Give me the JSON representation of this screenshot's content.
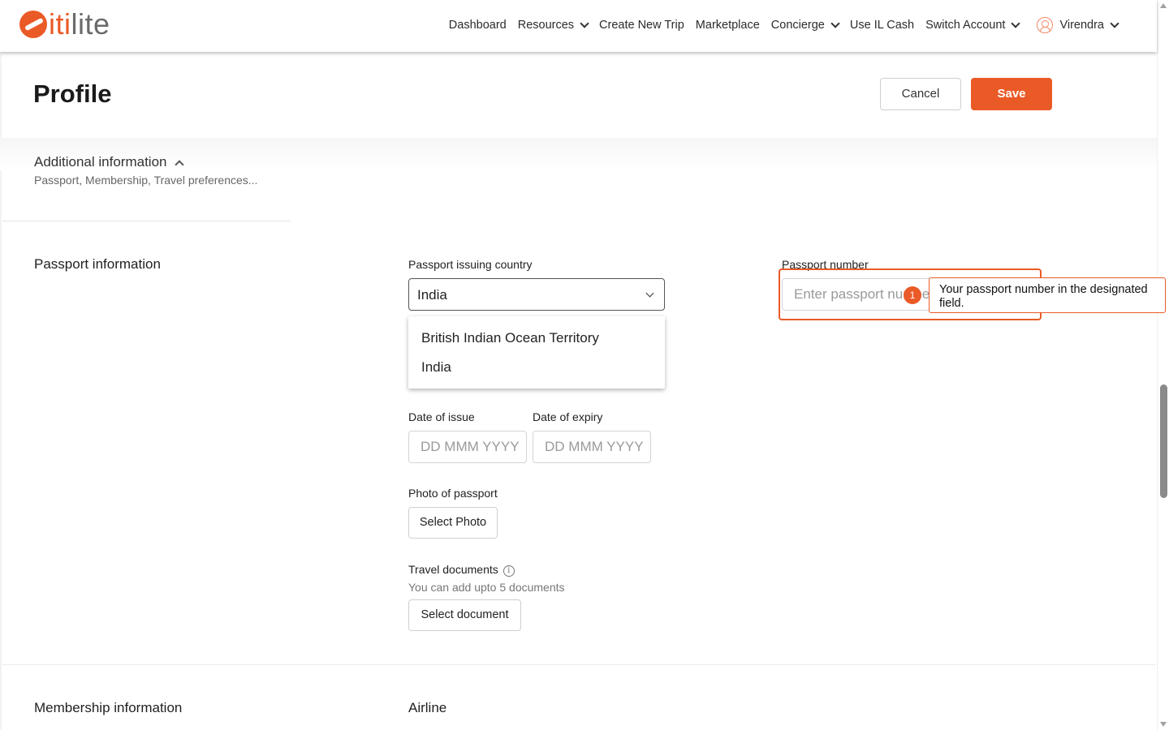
{
  "brand": {
    "logo_text_accent": "iti",
    "logo_text_rest": "lite",
    "accent_color": "#ea5a27"
  },
  "nav": {
    "dashboard": "Dashboard",
    "resources": "Resources",
    "create_trip": "Create New Trip",
    "marketplace": "Marketplace",
    "concierge": "Concierge",
    "il_cash": "Use IL Cash",
    "switch_account": "Switch Account",
    "user_name": "Virendra"
  },
  "page": {
    "title": "Profile",
    "cancel_label": "Cancel",
    "save_label": "Save"
  },
  "additional_info": {
    "title": "Additional information",
    "subtitle": "Passport, Membership, Travel preferences..."
  },
  "passport": {
    "section_title": "Passport information",
    "country_label": "Passport issuing country",
    "country_value": "India",
    "country_options": [
      "British Indian Ocean Territory",
      "India"
    ],
    "number_label": "Passport number",
    "number_placeholder": "Enter passport number",
    "issue_label": "Date of issue",
    "issue_placeholder": "DD MMM YYYY",
    "expiry_label": "Date of expiry",
    "expiry_placeholder": "DD MMM YYYY",
    "photo_label": "Photo of passport",
    "photo_button": "Select Photo",
    "docs_label": "Travel documents",
    "docs_help": "You can add upto 5 documents",
    "docs_button": "Select document"
  },
  "guide": {
    "step": "1",
    "tooltip": "Your passport number in the designated field."
  },
  "membership": {
    "section_title": "Membership information",
    "airline_label": "Airline"
  }
}
